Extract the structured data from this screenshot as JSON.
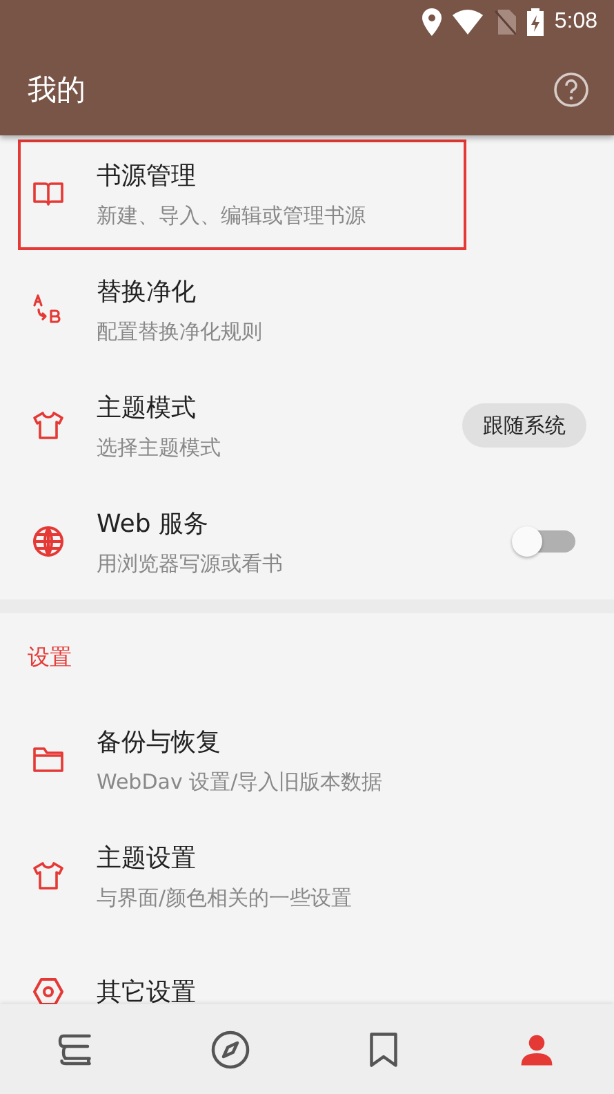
{
  "status_bar": {
    "time": "5:08"
  },
  "app_bar": {
    "title": "我的"
  },
  "items": [
    {
      "kind": "link",
      "title": "书源管理",
      "subtitle": "新建、导入、编辑或管理书源",
      "highlighted": true
    },
    {
      "kind": "link",
      "title": "替换净化",
      "subtitle": "配置替换净化规则",
      "highlighted": false
    },
    {
      "kind": "chip",
      "title": "主题模式",
      "subtitle": "选择主题模式",
      "value": "跟随系统",
      "highlighted": false
    },
    {
      "kind": "switch",
      "title": "Web 服务",
      "subtitle": "用浏览器写源或看书",
      "on": false,
      "highlighted": false
    }
  ],
  "settings": {
    "header": "设置",
    "items": [
      {
        "title": "备份与恢复",
        "subtitle": "WebDav 设置/导入旧版本数据"
      },
      {
        "title": "主题设置",
        "subtitle": "与界面/颜色相关的一些设置"
      },
      {
        "title": "其它设置"
      }
    ]
  },
  "bottom_nav": [
    {
      "selected": false
    },
    {
      "selected": false
    },
    {
      "selected": false
    },
    {
      "selected": true
    }
  ]
}
